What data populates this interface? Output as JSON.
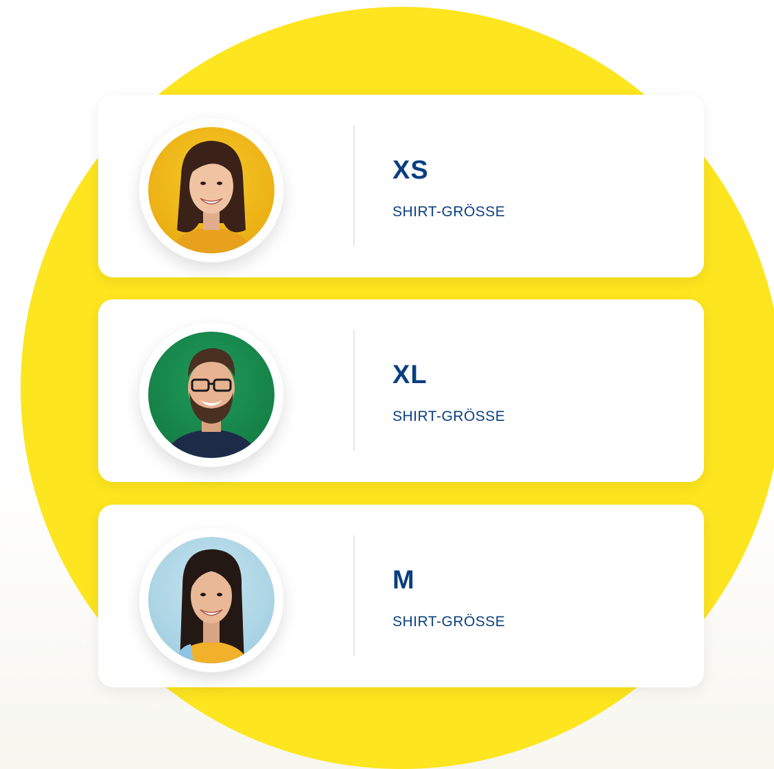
{
  "colors": {
    "accent_yellow": "#fde51f",
    "text_blue": "#0a3f7f",
    "card_bg": "#ffffff"
  },
  "cards": [
    {
      "size": "XS",
      "label": "SHIRT-GRÖSSE",
      "avatar": "woman-yellow-background-avatar"
    },
    {
      "size": "XL",
      "label": "SHIRT-GRÖSSE",
      "avatar": "man-glasses-green-background-avatar"
    },
    {
      "size": "M",
      "label": "SHIRT-GRÖSSE",
      "avatar": "woman-light-blue-background-avatar"
    }
  ]
}
